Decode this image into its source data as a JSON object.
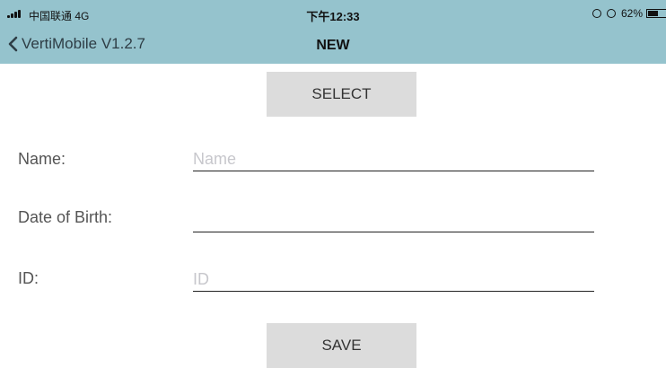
{
  "status_bar": {
    "carrier": "中国联通 4G",
    "time": "下午12:33",
    "battery_percent": "62%",
    "battery_level": 0.62,
    "icons": [
      "signal-icon",
      "screen-rotation-lock-icon",
      "alarm-icon",
      "battery-icon"
    ]
  },
  "nav": {
    "back_label": "VertiMobile V1.2.7",
    "title": "NEW"
  },
  "form": {
    "select_label": "SELECT",
    "name_label": "Name:",
    "name_value": "",
    "name_placeholder": "Name",
    "dob_label": "Date of Birth:",
    "dob_value": "",
    "dob_placeholder": "",
    "id_label": "ID:",
    "id_value": "",
    "id_placeholder": "ID",
    "save_label": "SAVE"
  },
  "colors": {
    "header_bg": "#95c3cd",
    "button_bg": "#dcdcdc",
    "underline": "#222222"
  }
}
